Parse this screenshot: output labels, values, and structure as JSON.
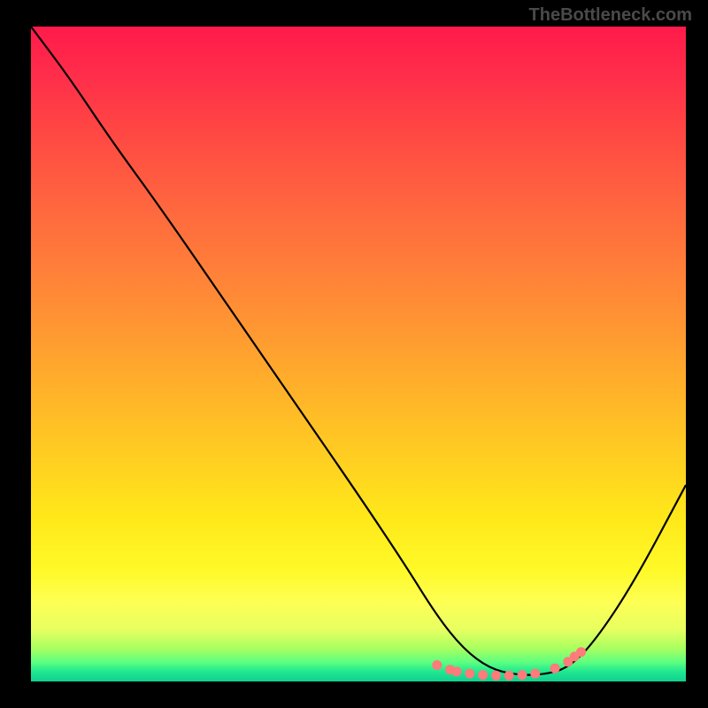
{
  "watermark": "TheBottleneck.com",
  "chart_data": {
    "type": "line",
    "title": "",
    "xlabel": "",
    "ylabel": "",
    "xlim": [
      0,
      100
    ],
    "ylim": [
      0,
      100
    ],
    "series": [
      {
        "name": "bottleneck-curve",
        "x": [
          0,
          6,
          12,
          20,
          30,
          40,
          50,
          57,
          62,
          66,
          70,
          74,
          78,
          82,
          86,
          92,
          100
        ],
        "y": [
          100,
          92,
          83,
          72,
          57.5,
          43,
          28.5,
          18,
          10,
          5,
          2,
          1,
          1,
          2,
          6,
          15,
          30
        ]
      }
    ],
    "markers": {
      "name": "optimal-range",
      "color": "#ff7a7a",
      "x": [
        62,
        64,
        65,
        67,
        69,
        71,
        73,
        75,
        77,
        80,
        82,
        83,
        84
      ],
      "y": [
        2.5,
        1.8,
        1.5,
        1.2,
        1.0,
        0.9,
        0.9,
        1.0,
        1.2,
        2.0,
        3.0,
        3.8,
        4.5
      ]
    },
    "gradient": {
      "top_color": "#ff1a4a",
      "bottom_color": "#10d090"
    }
  }
}
